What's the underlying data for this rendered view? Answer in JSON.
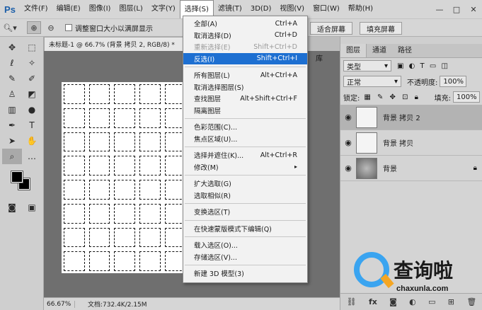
{
  "app": {
    "logo": "Ps"
  },
  "menubar": {
    "items": [
      "文件(F)",
      "编辑(E)",
      "图像(I)",
      "图层(L)",
      "文字(Y)",
      "选择(S)",
      "滤镜(T)",
      "3D(D)",
      "视图(V)",
      "窗口(W)",
      "帮助(H)"
    ],
    "active_index": 5
  },
  "window_controls": {
    "minimize": "—",
    "restore": "□",
    "close": "✕"
  },
  "options": {
    "checkbox_label": "调整窗口大小以满屏显示",
    "fit_screen": "适合屏幕",
    "fill_screen": "填充屏幕"
  },
  "document": {
    "tab_title": "未标题-1 @ 66.7% (背景 拷贝 2, RGB/8) *",
    "zoom": "66.67%",
    "doc_info": "文档:732.4K/2.15M"
  },
  "select_menu": {
    "items": [
      {
        "label": "全部(A)",
        "shortcut": "Ctrl+A",
        "state": "normal"
      },
      {
        "label": "取消选择(D)",
        "shortcut": "Ctrl+D",
        "state": "normal"
      },
      {
        "label": "重新选择(E)",
        "shortcut": "Shift+Ctrl+D",
        "state": "disabled"
      },
      {
        "label": "反选(I)",
        "shortcut": "Shift+Ctrl+I",
        "state": "highlighted"
      },
      {
        "sep": true
      },
      {
        "label": "所有图层(L)",
        "shortcut": "Alt+Ctrl+A",
        "state": "normal"
      },
      {
        "label": "取消选择图层(S)",
        "shortcut": "",
        "state": "normal"
      },
      {
        "label": "查找图层",
        "shortcut": "Alt+Shift+Ctrl+F",
        "state": "normal"
      },
      {
        "label": "隔离图层",
        "shortcut": "",
        "state": "normal"
      },
      {
        "sep": true
      },
      {
        "label": "色彩范围(C)...",
        "shortcut": "",
        "state": "normal"
      },
      {
        "label": "焦点区域(U)...",
        "shortcut": "",
        "state": "normal"
      },
      {
        "sep": true
      },
      {
        "label": "选择并遮住(K)...",
        "shortcut": "Alt+Ctrl+R",
        "state": "normal"
      },
      {
        "label": "修改(M)",
        "shortcut": "▸",
        "state": "normal"
      },
      {
        "sep": true
      },
      {
        "label": "扩大选取(G)",
        "shortcut": "",
        "state": "normal"
      },
      {
        "label": "选取相似(R)",
        "shortcut": "",
        "state": "normal"
      },
      {
        "sep": true
      },
      {
        "label": "变换选区(T)",
        "shortcut": "",
        "state": "normal"
      },
      {
        "sep": true
      },
      {
        "label": "在快速蒙版模式下编辑(Q)",
        "shortcut": "",
        "state": "normal"
      },
      {
        "sep": true
      },
      {
        "label": "载入选区(O)...",
        "shortcut": "",
        "state": "normal"
      },
      {
        "label": "存储选区(V)...",
        "shortcut": "",
        "state": "normal"
      },
      {
        "sep": true
      },
      {
        "label": "新建 3D 模型(3)",
        "shortcut": "",
        "state": "normal"
      }
    ]
  },
  "layers_panel": {
    "tabs": [
      "图层",
      "通道",
      "路径"
    ],
    "kind_filter": "类型",
    "blend_mode": "正常",
    "opacity_label": "不透明度:",
    "opacity_value": "100%",
    "lock_label": "锁定:",
    "fill_label": "填充:",
    "fill_value": "100%",
    "layers": [
      {
        "name": "背景 拷贝 2",
        "selected": true,
        "locked": false
      },
      {
        "name": "背景 拷贝",
        "selected": false,
        "locked": false
      },
      {
        "name": "背景",
        "selected": false,
        "locked": true
      }
    ],
    "footer_icons": [
      "link-icon",
      "fx-icon",
      "mask-icon",
      "adjustment-icon",
      "group-icon",
      "new-layer-icon",
      "trash-icon"
    ]
  },
  "side_panel_label": "库",
  "watermark": {
    "brand": "查询啦",
    "url": "chaxunla.com"
  },
  "colors": {
    "menu_highlight": "#1d6fd1",
    "canvas_bg": "#6f6f6f",
    "watermark_blue": "#3aa4f0"
  }
}
